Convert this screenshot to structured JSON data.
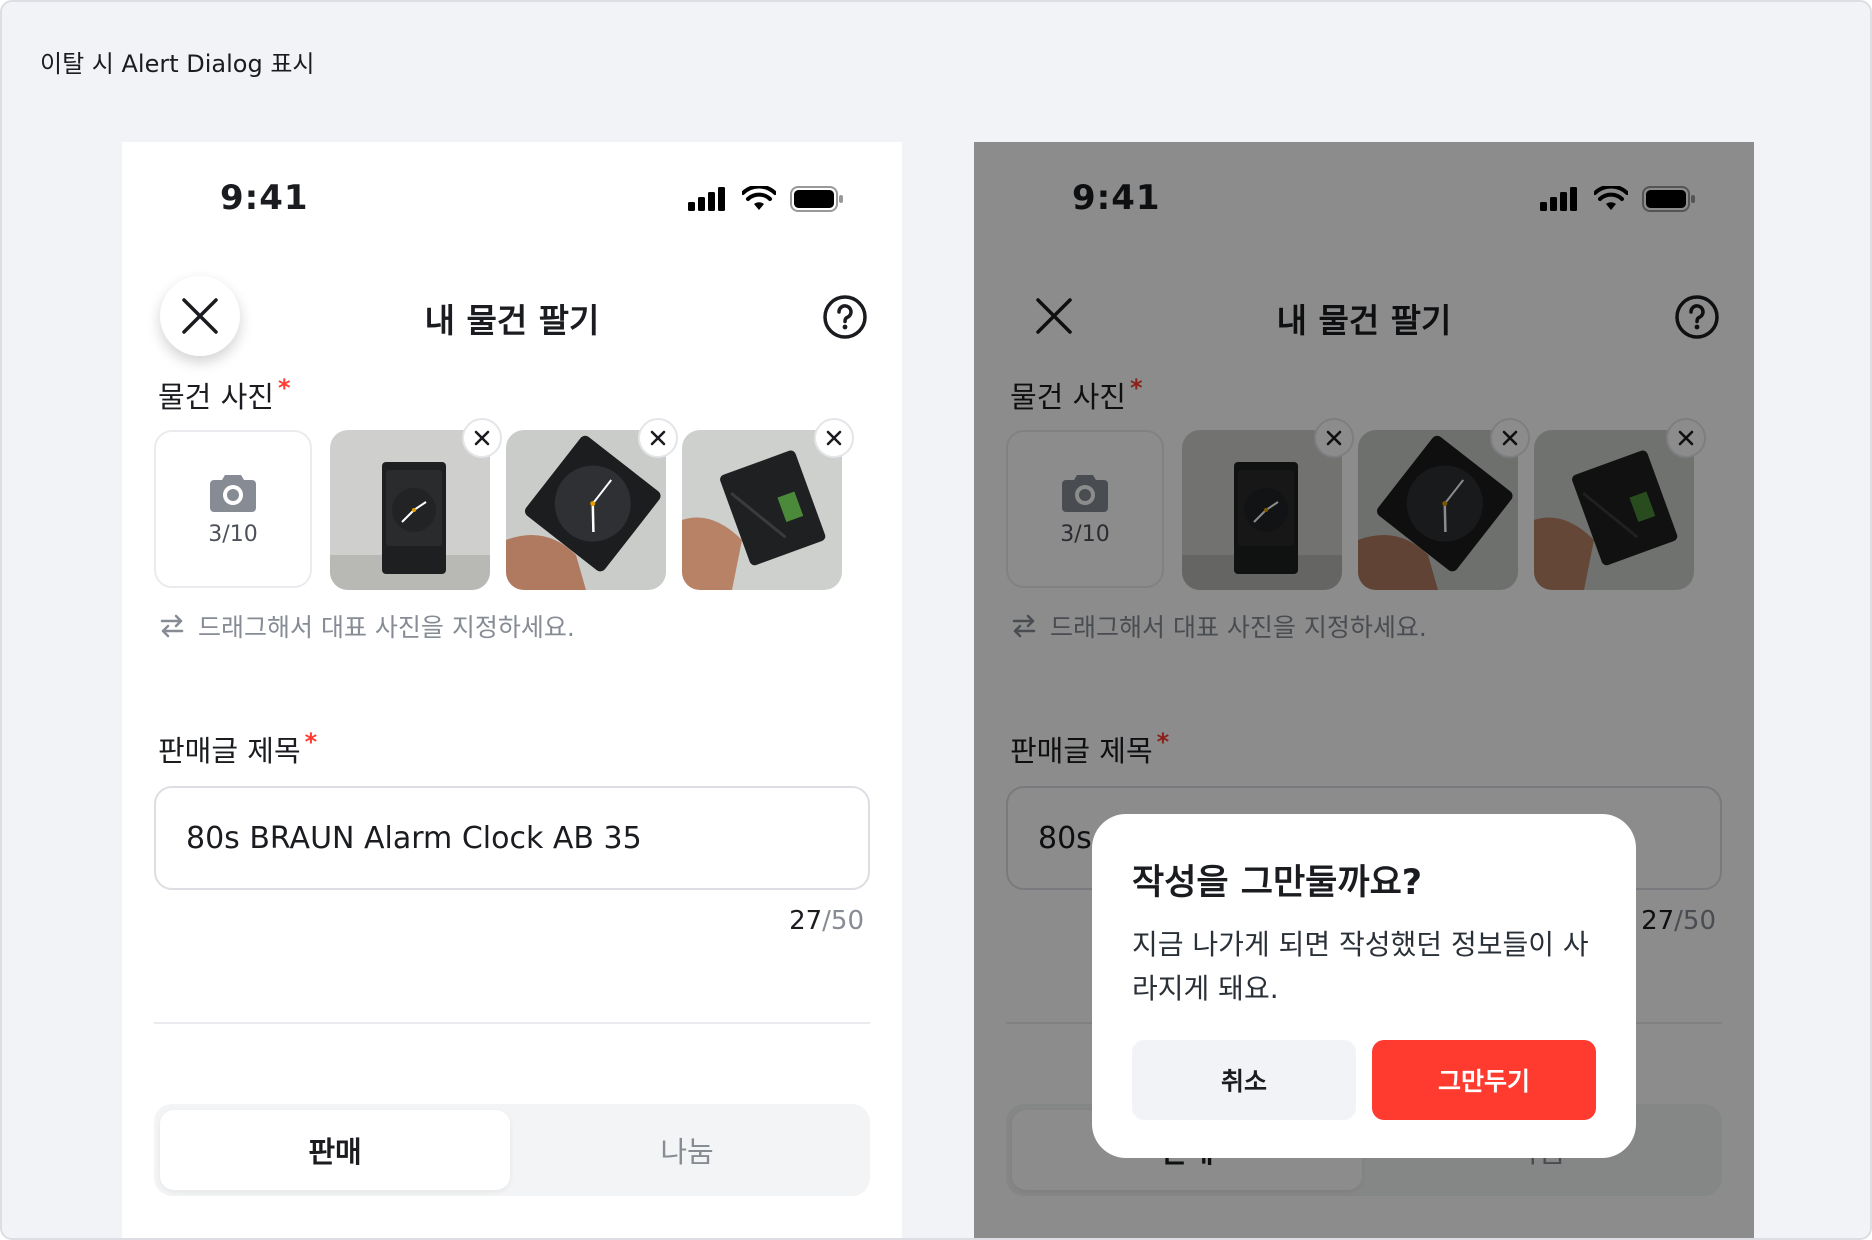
{
  "board": {
    "label": "이탈 시 Alert Dialog 표시"
  },
  "status": {
    "time": "9:41"
  },
  "nav": {
    "title": "내 물건 팔기"
  },
  "photo_section": {
    "label": "물건 사진",
    "required_mark": "*",
    "camera_count": "3/10",
    "drag_hint": "드래그해서 대표 사진을 지정하세요."
  },
  "title_section": {
    "label": "판매글 제목",
    "required_mark": "*",
    "input_value": "80s BRAUN Alarm Clock AB 35",
    "count_current": "27",
    "count_max": "/50"
  },
  "segment": {
    "sell_label": "판매",
    "share_label": "나눔"
  },
  "dialog": {
    "title": "작성을 그만둘까요?",
    "message": "지금 나가게 되면 작성했던 정보들이 사라지게 돼요.",
    "cancel_label": "취소",
    "confirm_label": "그만두기"
  },
  "colors": {
    "accent": "#ff3b30",
    "dim_overlay": "rgba(0,0,0,0.45)"
  },
  "icons": [
    "close-icon",
    "help-icon",
    "camera-icon",
    "remove-icon",
    "swap-arrows-icon",
    "signal-icon",
    "wifi-icon",
    "battery-icon"
  ]
}
